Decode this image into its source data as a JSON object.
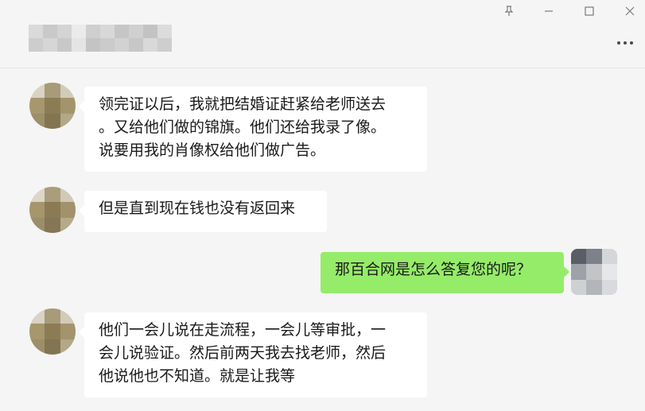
{
  "window": {
    "title_hidden": true,
    "controls": {
      "pin": "pin-icon",
      "minimize": "minimize-icon",
      "maximize": "maximize-icon",
      "close": "close-icon"
    },
    "more_icon": "more-icon"
  },
  "colors": {
    "background": "#f5f5f5",
    "incoming_bubble": "#ffffff",
    "outgoing_bubble": "#95ec69",
    "text": "#1a1a1a"
  },
  "messages": [
    {
      "sender": "other",
      "lines": [
        "领完证以后，我就把结婚证赶紧给老师送去",
        "。又给他们做的锦旗。他们还给我录了像。",
        "说要用我的肖像权给他们做广告。"
      ]
    },
    {
      "sender": "other",
      "lines": [
        "但是直到现在钱也没有返回来"
      ]
    },
    {
      "sender": "self",
      "lines": [
        "那百合网是怎么答复您的呢？"
      ]
    },
    {
      "sender": "other",
      "lines": [
        "他们一会儿说在走流程，一会儿等审批，一",
        "会儿说验证。然后前两天我去找老师，然后",
        "他说他也不知道。就是让我等"
      ]
    }
  ]
}
